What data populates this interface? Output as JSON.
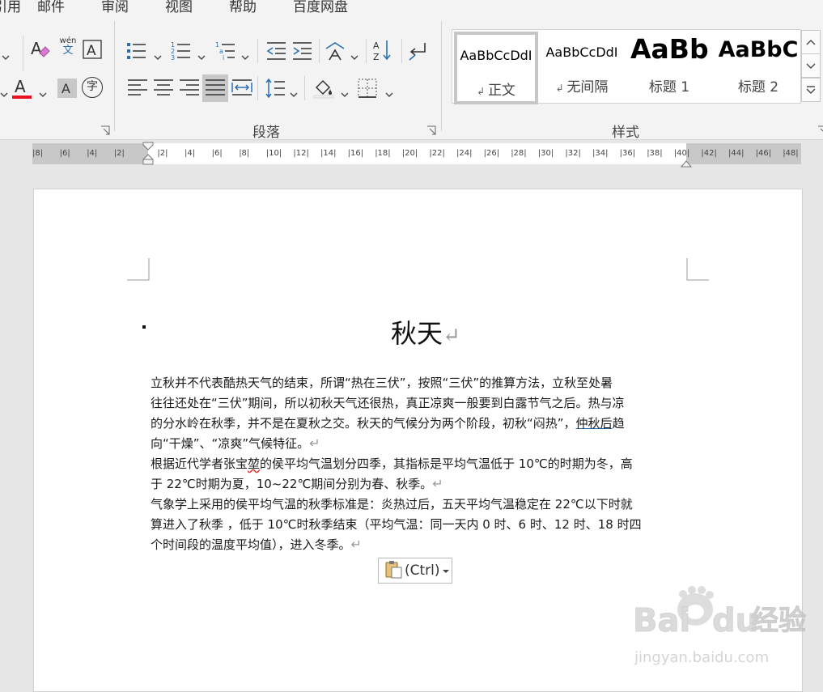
{
  "ribbon_tabs": [
    "引用",
    "邮件",
    "审阅",
    "视图",
    "帮助",
    "百度网盘"
  ],
  "groups": {
    "paragraph": "段落",
    "styles": "样式"
  },
  "font_icons": {
    "phonetic_top": "wén",
    "phonetic_bottom": "文",
    "enclose_char": "字"
  },
  "styles_gallery": [
    {
      "preview": "AaBbCcDdI",
      "name": "正文",
      "selected": true
    },
    {
      "preview": "AaBbCcDdI",
      "name": "无间隔",
      "selected": false
    },
    {
      "preview": "AaBb",
      "name": "标题 1",
      "selected": false
    },
    {
      "preview": "AaBbC",
      "name": "标题 2",
      "selected": false
    }
  ],
  "ruler_numbers": [
    "8",
    "6",
    "4",
    "2",
    "2",
    "4",
    "6",
    "8",
    "10",
    "12",
    "14",
    "16",
    "18",
    "20",
    "22",
    "24",
    "26",
    "28",
    "30",
    "32",
    "34",
    "36",
    "38",
    "40",
    "42",
    "44",
    "46",
    "48"
  ],
  "document": {
    "title": "秋天",
    "para_mark": "↵",
    "lines": [
      {
        "text": "立秋并不代表酷热天气的结束，所谓“热在三伏”，按照“三伏”的推算方法，立秋至处暑"
      },
      {
        "text": "往往还处在“三伏”期间，所以初秋天气还很热，真正凉爽一般要到白露节气之后。热与凉"
      },
      {
        "pre": "的分水岭在秋季，并不是在夏秋之交。秋天的气候分为两个阶段，初秋“闷热”，",
        "under": "仲秋后",
        "post": "趋"
      },
      {
        "text": "向“干燥”、“凉爽”气候特征。"
      },
      {
        "pre": "根据近代学者张宝",
        "squiggle": "堃",
        "post": "的侯平均气温划分四季，其指标是平均气温低于  10℃的时期为冬，高"
      },
      {
        "text": "于 22℃时期为夏，10~22℃期间分别为春、秋季。"
      },
      {
        "text": "气象学上采用的侯平均气温的秋季标准是：炎热过后，五天平均气温稳定在  22℃以下时就"
      },
      {
        "text": "算进入了秋季 ，低于 10℃时秋季结束（平均气温：同一天内 0 时、6 时、12 时、18 时四"
      },
      {
        "text": "个时间段的温度平均值），进入冬季。"
      }
    ]
  },
  "paste_options": {
    "label": "(Ctrl)"
  },
  "watermark": {
    "brand_left": "Bai",
    "brand_right": "du",
    "brand_cn": "经验",
    "url": "jingyan.baidu.com"
  },
  "colors": {
    "font_color_bar": "#e81123",
    "shading": "#c8c8c8",
    "accent": "#2a6fb3"
  }
}
